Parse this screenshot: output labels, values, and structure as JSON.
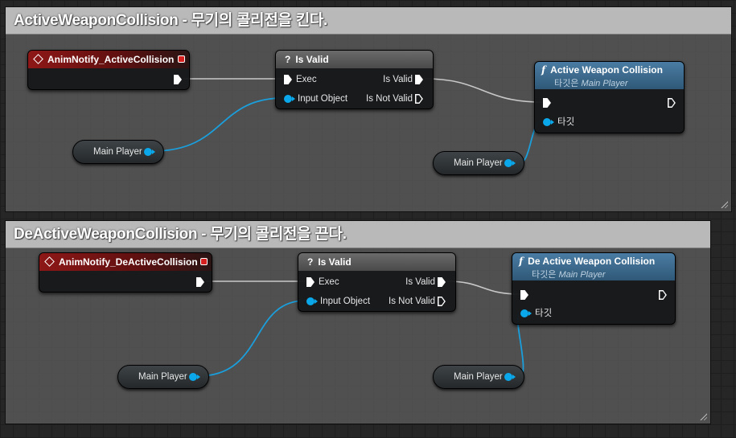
{
  "comments": [
    {
      "title": "ActiveWeaponCollision - 무기의 콜리전을 킨다.",
      "event_node": {
        "title": "AnimNotify_ActiveCollision"
      },
      "is_valid_node": {
        "title": "Is Valid",
        "exec_in": "Exec",
        "object_in": "Input Object",
        "out_valid": "Is Valid",
        "out_not_valid": "Is Not Valid"
      },
      "function_node": {
        "title": "Active Weapon Collision",
        "target_prefix": "타깃은",
        "target_class": "Main Player",
        "target_pin": "타깃"
      },
      "var_nodes": [
        {
          "label": "Main Player"
        },
        {
          "label": "Main Player"
        }
      ]
    },
    {
      "title": "DeActiveWeaponCollision - 무기의 콜리전을 끈다.",
      "event_node": {
        "title": "AnimNotify_DeActiveCollision"
      },
      "is_valid_node": {
        "title": "Is Valid",
        "exec_in": "Exec",
        "object_in": "Input Object",
        "out_valid": "Is Valid",
        "out_not_valid": "Is Not Valid"
      },
      "function_node": {
        "title": "De Active Weapon Collision",
        "target_prefix": "타깃은",
        "target_class": "Main Player",
        "target_pin": "타깃"
      },
      "var_nodes": [
        {
          "label": "Main Player"
        },
        {
          "label": "Main Player"
        }
      ]
    }
  ],
  "colors": {
    "exec_wire": "#c8c8c8",
    "object_wire": "#1a9fdc",
    "event_header": "#8e1717",
    "function_header": "#4a7ca3"
  }
}
